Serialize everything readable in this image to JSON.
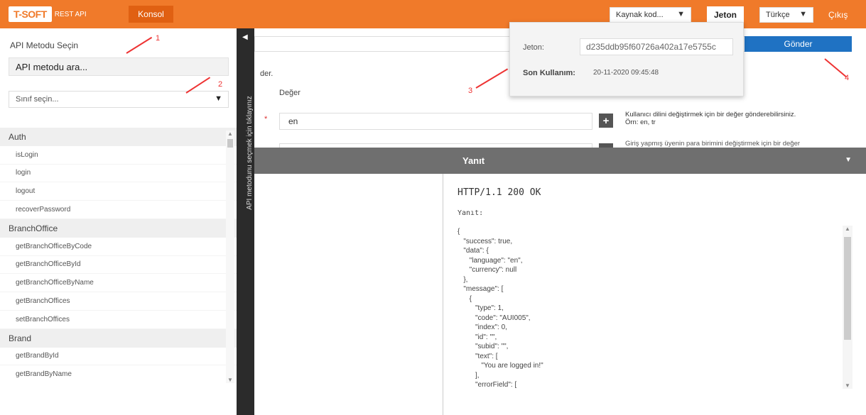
{
  "topbar": {
    "logo_text": "T-SOFT",
    "logo_sub": "REST API",
    "konsol": "Konsol",
    "source_select": "Kaynak kod...",
    "jeton_button": "Jeton",
    "language_select": "Türkçe",
    "logout": "Çıkış"
  },
  "sidebar": {
    "title": "API Metodu Seçin",
    "search_value": "API metodu ara...",
    "class_select": "Sınıf seçin...",
    "annotations": [
      "1",
      "2"
    ],
    "groups": [
      {
        "name": "Auth",
        "items": [
          "isLogin",
          "login",
          "logout",
          "recoverPassword"
        ]
      },
      {
        "name": "BranchOffice",
        "items": [
          "getBranchOfficeByCode",
          "getBranchOfficeById",
          "getBranchOfficeByName",
          "getBranchOffices",
          "setBranchOffices"
        ]
      },
      {
        "name": "Brand",
        "items": [
          "getBrandById",
          "getBrandByName"
        ]
      }
    ]
  },
  "vstrip": {
    "text": "API metodunu seçmek için tıklayınız"
  },
  "main": {
    "gonder": "Gönder",
    "frag_der": "der.",
    "deger_header": "Değer",
    "param_value": "en",
    "required_mark": "*",
    "plus": "+",
    "param_desc_1": "Kullanıcı dilini değiştirmek için bir değer gönderebilirsiniz.",
    "param_desc_2": "Örn: en, tr",
    "param_desc_3": "Giriş yapmış üyenin para birimini değiştirmek için bir değer",
    "annotations": [
      "3",
      "4"
    ]
  },
  "token_popup": {
    "jeton_label": "Jeton:",
    "jeton_value": "d235ddb95f60726a402a17e5755c",
    "son_kullanim_label": "Son Kullanım:",
    "son_kullanim_value": "20-11-2020 09:45:48"
  },
  "response": {
    "header": "Yanıt",
    "status_line": "HTTP/1.1 200 OK",
    "label": "Yanıt:",
    "body": "{\n   \"success\": true,\n   \"data\": {\n      \"language\": \"en\",\n      \"currency\": null\n   },\n   \"message\": [\n      {\n         \"type\": 1,\n         \"code\": \"AUI005\",\n         \"index\": 0,\n         \"id\": \"\",\n         \"subid\": \"\",\n         \"text\": [\n            \"You are logged in!\"\n         ],\n         \"errorField\": [\n"
  },
  "colors": {
    "topbar": "#f07a2a",
    "konsol_active": "#e06012",
    "gonder": "#1f72c3",
    "annotation": "#e33333",
    "vstrip": "#2b2b2b",
    "response_header": "#6f6f6f"
  }
}
